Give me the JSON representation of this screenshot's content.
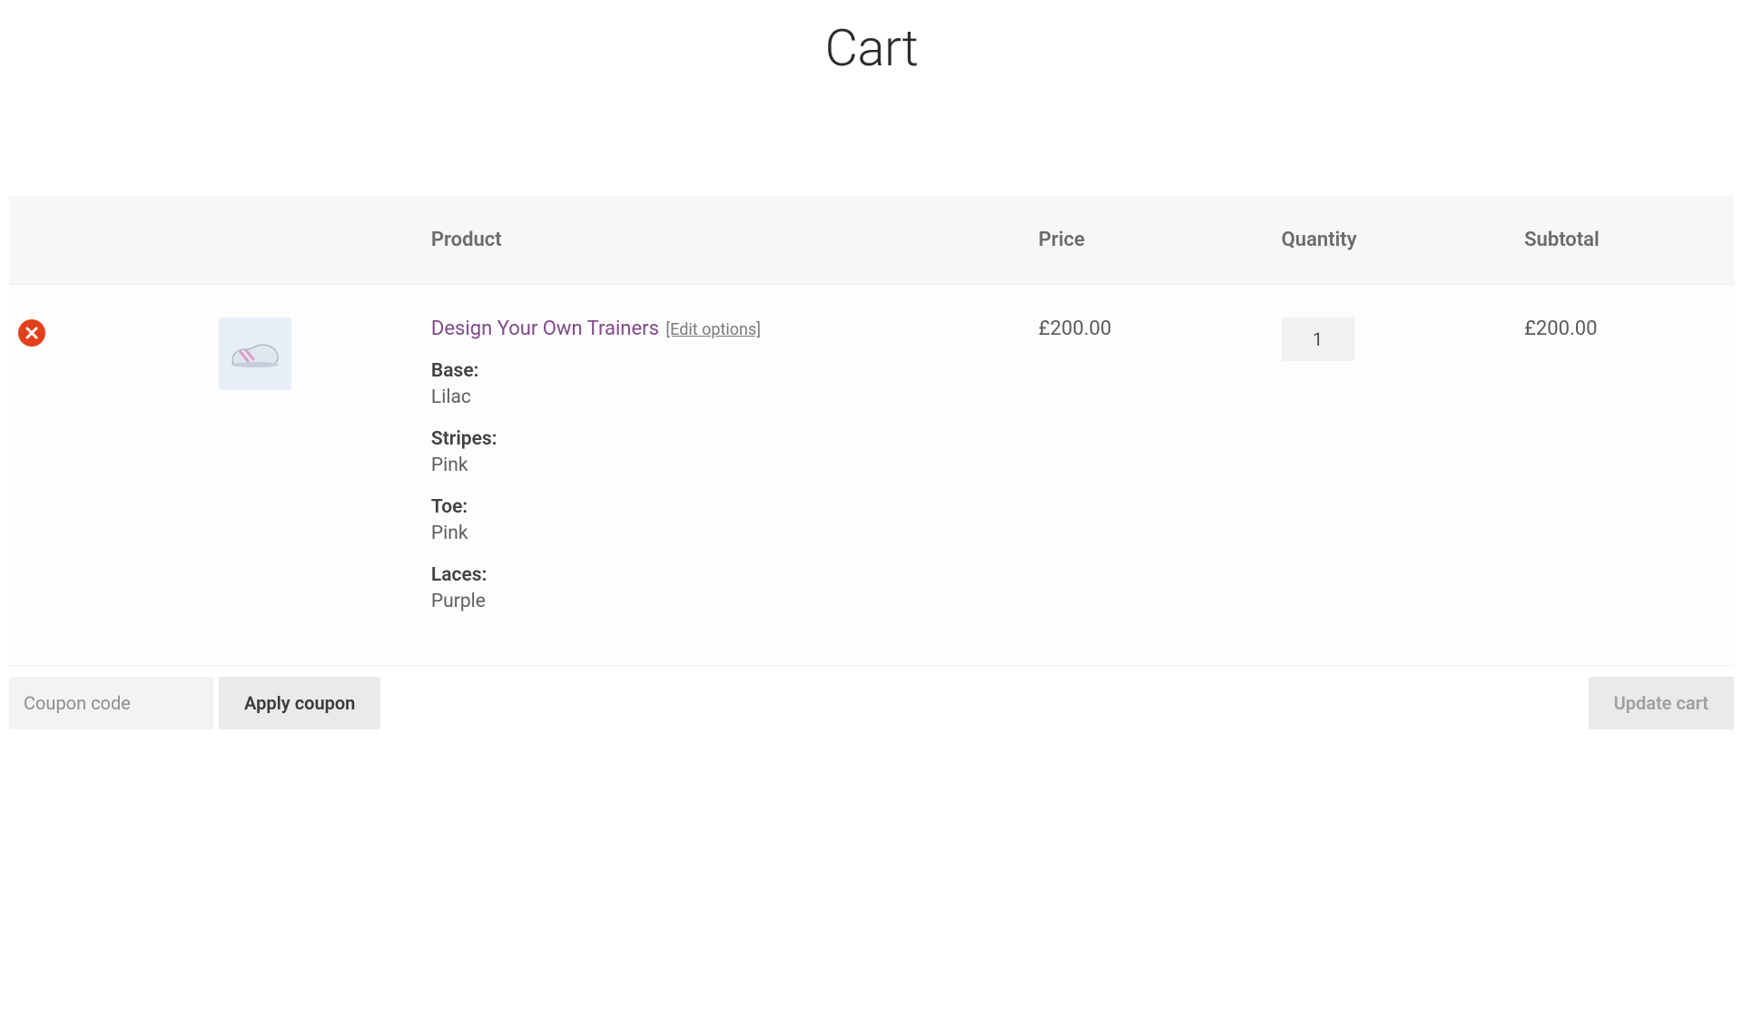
{
  "page": {
    "title": "Cart"
  },
  "table": {
    "headers": {
      "product": "Product",
      "price": "Price",
      "quantity": "Quantity",
      "subtotal": "Subtotal"
    }
  },
  "item": {
    "name": "Design Your Own Trainers",
    "edit_label": "[Edit options]",
    "price": "£200.00",
    "quantity": "1",
    "subtotal": "£200.00",
    "variations": [
      {
        "label": "Base:",
        "value": "Lilac"
      },
      {
        "label": "Stripes:",
        "value": "Pink"
      },
      {
        "label": "Toe:",
        "value": "Pink"
      },
      {
        "label": "Laces:",
        "value": "Purple"
      }
    ]
  },
  "coupon": {
    "placeholder": "Coupon code",
    "apply_label": "Apply coupon"
  },
  "update_cart_label": "Update cart"
}
